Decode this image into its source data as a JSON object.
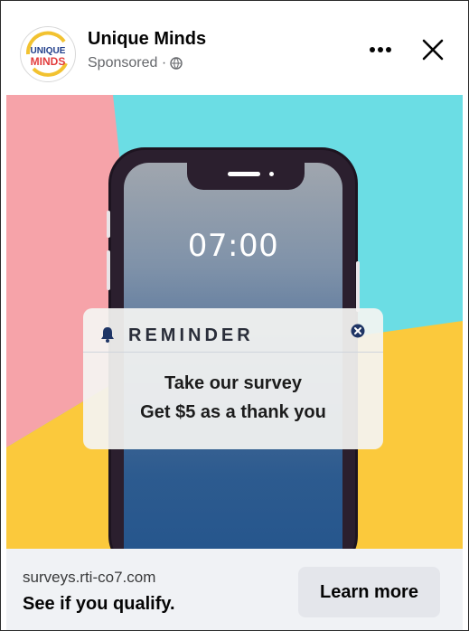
{
  "post": {
    "page_name": "Unique Minds",
    "sponsored_label": "Sponsored ·",
    "logo_text": {
      "line1": "UNIQUE",
      "line2": "MINDS"
    }
  },
  "actions": {
    "more_label": "•••",
    "close_label": "✕"
  },
  "creative": {
    "clock_time": "07:00",
    "reminder_title": "REMINDER",
    "reminder_line1": "Take our survey",
    "reminder_line2": "Get $5 as a thank you",
    "background_colors": {
      "pink": "#f6a3a9",
      "cyan": "#6bdde4",
      "yellow": "#fbc93c"
    }
  },
  "footer": {
    "domain": "surveys.rti-co7.com",
    "headline": "See if you qualify.",
    "cta_label": "Learn more"
  },
  "icons": {
    "globe": "globe-icon",
    "bell": "bell-icon",
    "close_small": "close-circle-icon"
  }
}
